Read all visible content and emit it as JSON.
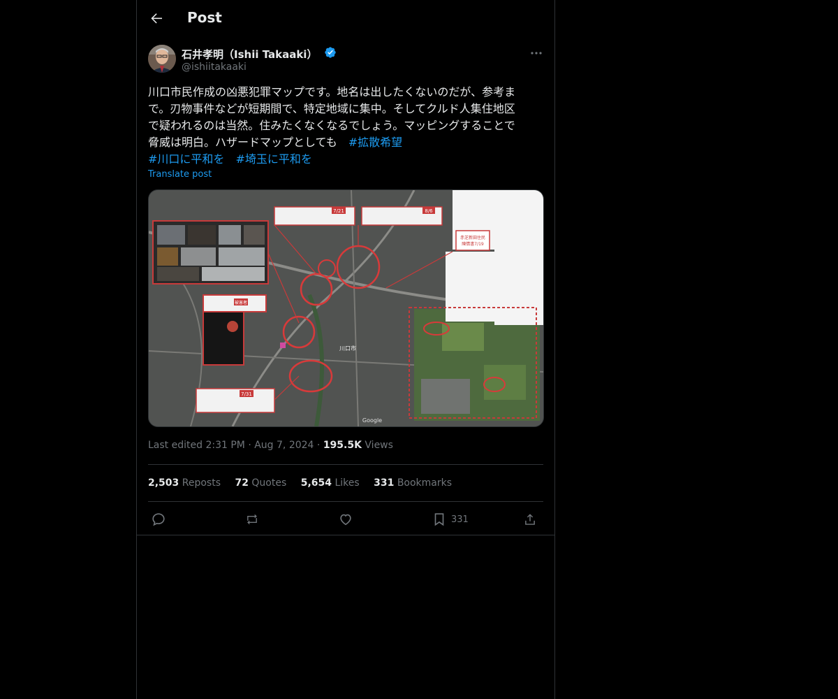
{
  "header": {
    "title": "Post"
  },
  "author": {
    "display_name": "石井孝明（Ishii Takaaki）",
    "handle": "@ishiitakaaki",
    "verified_color": "#1d9bf0"
  },
  "post": {
    "text_line1": "川口市民作成の凶悪犯罪マップです。地名は出したくないのだが、参考ま",
    "text_line2": "で。刃物事件などが短期間で、特定地域に集中。そしてクルド人集住地区",
    "text_line3": "で疑われるのは当然。住みたくなくなるでしょう。マッピングすることで",
    "text_line4": "脅威は明白。ハザードマップとしても　",
    "hashtag1": "#拡散希望",
    "hashtag2": "#川口に平和を",
    "hashtag3": "#埼玉に平和を",
    "translate_label": "Translate post"
  },
  "media": {
    "city_label": "川口市",
    "stamp1": "7/21",
    "stamp2": "8/6",
    "stamp3": "7/31",
    "stamp4": "被害者",
    "red_note": "赤芝新田住民\n陳情書7/19",
    "google_label": "Google"
  },
  "meta": {
    "edited": "Last edited 2:31 PM",
    "date": "Aug 7, 2024",
    "views_count": "195.5K",
    "views_label": "Views"
  },
  "stats": {
    "reposts_count": "2,503",
    "reposts_label": "Reposts",
    "quotes_count": "72",
    "quotes_label": "Quotes",
    "likes_count": "5,654",
    "likes_label": "Likes",
    "bookmarks_count": "331",
    "bookmarks_label": "Bookmarks"
  },
  "actions": {
    "bookmark_count": "331"
  },
  "icons": [
    "back-arrow-icon",
    "verified-icon",
    "more-icon",
    "reply-icon",
    "repost-icon",
    "like-icon",
    "bookmark-icon",
    "share-icon"
  ],
  "colors": {
    "background": "#000000",
    "text": "#e7e9ea",
    "muted": "#71767b",
    "accent": "#1d9bf0",
    "border": "#2f3336"
  }
}
